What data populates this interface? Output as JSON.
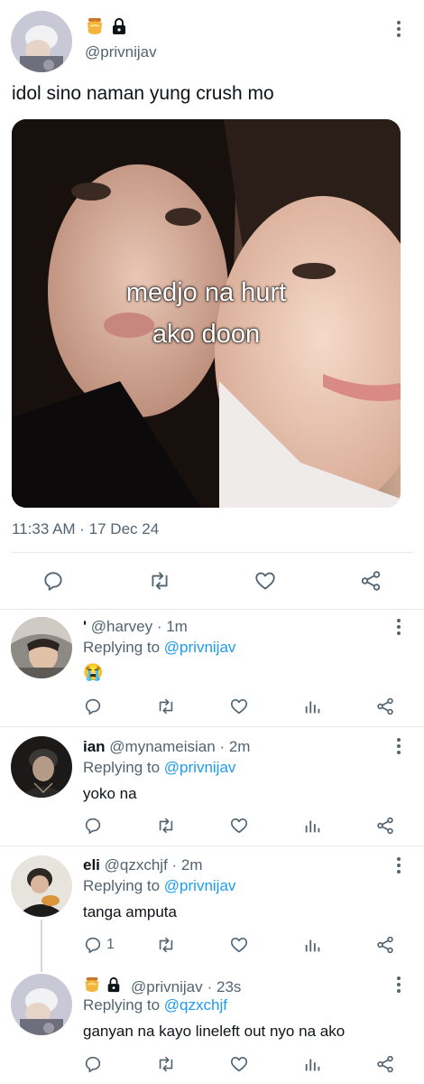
{
  "main_tweet": {
    "badges": [
      "honey-pot-icon",
      "lock-icon"
    ],
    "handle": "@privnijav",
    "text": "idol sino naman yung crush mo",
    "image_caption_line1": "medjo na hurt",
    "image_caption_line2": "ako doon",
    "timestamp": "11:33 AM · 17 Dec 24"
  },
  "replies": [
    {
      "name": "'",
      "handle": "@harvey",
      "time": "· 1m",
      "replying_label": "Replying to",
      "replying_to": "@privnijav",
      "text": "😭",
      "reply_count": ""
    },
    {
      "name": "ian",
      "handle": "@mynameisian",
      "time": "· 2m",
      "replying_label": "Replying to",
      "replying_to": "@privnijav",
      "text": "yoko na",
      "reply_count": ""
    },
    {
      "name": "eli",
      "handle": "@qzxchjf",
      "time": "· 2m",
      "replying_label": "Replying to",
      "replying_to": "@privnijav",
      "text": "tanga amputa",
      "reply_count": "1"
    },
    {
      "name": "",
      "handle": "@privnijav",
      "time": "· 23s",
      "replying_label": "Replying to",
      "replying_to": "@qzxchjf",
      "text": "ganyan na kayo lineleft out nyo na ako",
      "reply_count": ""
    }
  ],
  "colors": {
    "text": "#0f1419",
    "muted": "#536471",
    "link": "#1d9bf0",
    "divider": "#e6e9ec"
  }
}
